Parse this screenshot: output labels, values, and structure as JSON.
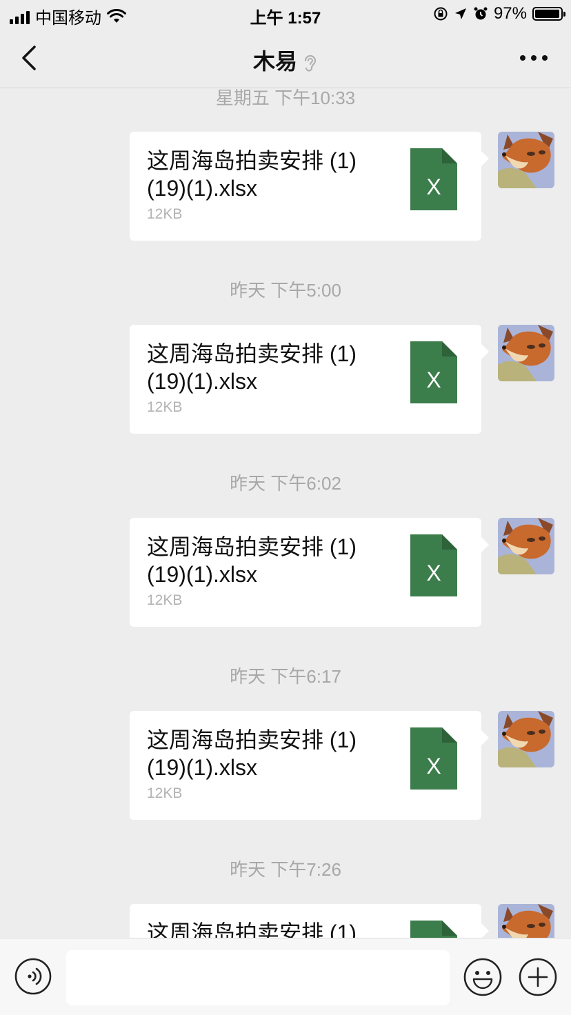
{
  "status_bar": {
    "carrier": "中国移动",
    "time": "上午 1:57",
    "battery_percent": "97%",
    "battery_level": 0.97,
    "icons": [
      "signal-icon",
      "wifi-icon",
      "orientation-lock-icon",
      "location-icon",
      "alarm-icon",
      "battery-icon"
    ]
  },
  "nav": {
    "title": "木易",
    "back_icon": "chevron-left-icon",
    "ear_icon": "ear-icon",
    "more_icon": "more-icon"
  },
  "messages": [
    {
      "timestamp": "星期五 下午10:33",
      "file_line1": "这周海岛拍卖安排 (1)",
      "file_line2": "(19)(1).xlsx",
      "size": "12KB"
    },
    {
      "timestamp": "昨天 下午5:00",
      "file_line1": "这周海岛拍卖安排 (1)",
      "file_line2": "(19)(1).xlsx",
      "size": "12KB"
    },
    {
      "timestamp": "昨天 下午6:02",
      "file_line1": "这周海岛拍卖安排 (1)",
      "file_line2": "(19)(1).xlsx",
      "size": "12KB"
    },
    {
      "timestamp": "昨天 下午6:17",
      "file_line1": "这周海岛拍卖安排 (1)",
      "file_line2": "(19)(1).xlsx",
      "size": "12KB"
    },
    {
      "timestamp": "昨天 下午7:26",
      "file_line1": "这周海岛拍卖安排 (1)",
      "file_line2": "",
      "size": ""
    }
  ],
  "file_icon": {
    "letter": "X",
    "color": "#3c7d4c"
  },
  "input_bar": {
    "voice_icon": "voice-icon",
    "text_value": "",
    "emoji_icon": "emoji-icon",
    "plus_icon": "plus-icon"
  }
}
